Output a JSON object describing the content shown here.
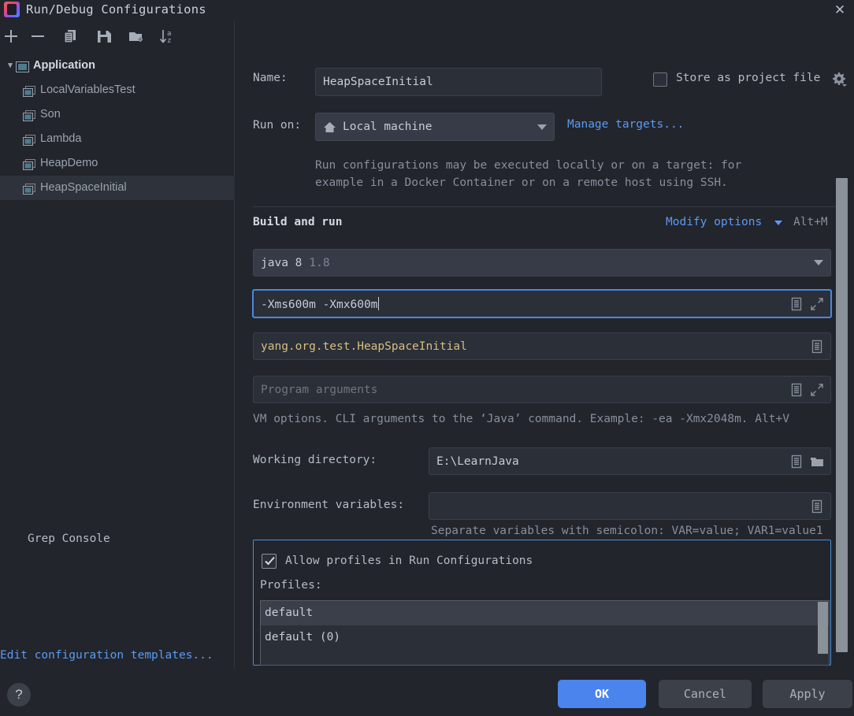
{
  "window": {
    "title": "Run/Debug Configurations",
    "logo_icon": "intellij-idea-logo",
    "close_icon": "close-icon"
  },
  "left_panel": {
    "toolbar": [
      {
        "name": "add-configuration",
        "icon": "plus-icon"
      },
      {
        "name": "remove-configuration",
        "icon": "minus-icon"
      },
      {
        "name": "copy-configuration",
        "icon": "copy-icon"
      },
      {
        "name": "save-configuration",
        "icon": "save-icon"
      },
      {
        "name": "move-into-folder",
        "icon": "new-folder-icon"
      },
      {
        "name": "sort-configurations",
        "icon": "sort-alphabetically-icon"
      }
    ],
    "tree": {
      "group": {
        "label": "Application",
        "icon": "application-icon",
        "expanded": true
      },
      "items": [
        {
          "label": "LocalVariablesTest",
          "icon": "application-icon",
          "selected": false
        },
        {
          "label": "Son",
          "icon": "application-icon",
          "selected": false
        },
        {
          "label": "Lambda",
          "icon": "application-icon",
          "selected": false
        },
        {
          "label": "HeapDemo",
          "icon": "application-icon",
          "selected": false
        },
        {
          "label": "HeapSpaceInitial",
          "icon": "application-icon",
          "selected": true
        }
      ]
    },
    "edit_templates_link": "Edit configuration templates..."
  },
  "form": {
    "name_label": "Name:",
    "name_value": "HeapSpaceInitial",
    "store_as_project_file_label": "Store as project file",
    "store_as_project_file_checked": false,
    "gear_icon": "gear-dropdown-icon",
    "run_on_label": "Run on:",
    "run_on_value": "Local machine",
    "run_on_icon": "home-icon",
    "manage_targets_link": "Manage targets...",
    "run_on_description": "Run configurations may be executed locally or on a target: for example in a Docker Container or on a remote host using SSH.",
    "build_and_run_title": "Build and run",
    "modify_options_label": "Modify options",
    "modify_options_shortcut": "Alt+M",
    "jdk_name": "java 8",
    "jdk_version": "1.8",
    "vm_options_value": "-Xms600m  -Xmx600m",
    "vm_options_focused": true,
    "main_class_value": "yang.org.test.HeapSpaceInitial",
    "program_arguments_placeholder": "Program arguments",
    "vm_options_hint": "VM options. CLI arguments to the ‘Java’ command. Example: -ea -Xmx2048m. Alt+V",
    "working_directory_label": "Working directory:",
    "working_directory_value": "E:\\LearnJava",
    "environment_variables_label": "Environment variables:",
    "environment_variables_value": "",
    "environment_variables_hint": "Separate variables with semicolon: VAR=value; VAR1=value1",
    "macro_icon": "insert-macro-icon",
    "expand_icon": "expand-editor-icon",
    "browse_icon": "browse-folder-icon"
  },
  "grep_console": {
    "legend": "Grep Console",
    "allow_profiles_label": "Allow profiles in Run Configurations",
    "allow_profiles_checked": true,
    "profiles_label": "Profiles:",
    "profiles": [
      {
        "label": "default",
        "selected": true
      },
      {
        "label": "default (0)",
        "selected": false
      }
    ]
  },
  "footer": {
    "help_label": "?",
    "ok_label": "OK",
    "cancel_label": "Cancel",
    "apply_label": "Apply"
  },
  "colors": {
    "background": "#22252c",
    "accent_blue": "#4a84ec",
    "link_blue": "#5a9bf0",
    "field_background": "#2b2f38",
    "combo_background": "#373b47",
    "main_class_text": "#d6bf7e",
    "selection": "#2e323a"
  }
}
